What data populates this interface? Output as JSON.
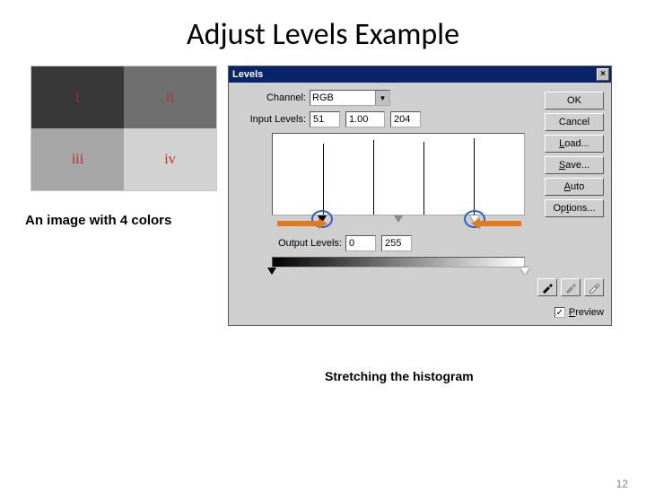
{
  "title": "Adjust Levels Example",
  "image": {
    "q1": "i",
    "q2": "ii",
    "q3": "iii",
    "q4": "iv"
  },
  "caption1": "An image with 4 colors",
  "caption2": "Stretching the histogram",
  "page_num": "12",
  "dlg": {
    "title": "Levels",
    "channel_label": "Channel:",
    "channel_value": "RGB",
    "input_label": "Input Levels:",
    "input_black": "51",
    "input_gray": "1.00",
    "input_white": "204",
    "output_label": "Output Levels:",
    "output_black": "0",
    "output_white": "255",
    "buttons": {
      "ok": "OK",
      "cancel": "Cancel",
      "load": "Load...",
      "save": "Save...",
      "auto": "Auto",
      "options": "Options..."
    },
    "preview_label": "Preview",
    "preview_checked": "✓",
    "close": "×"
  }
}
